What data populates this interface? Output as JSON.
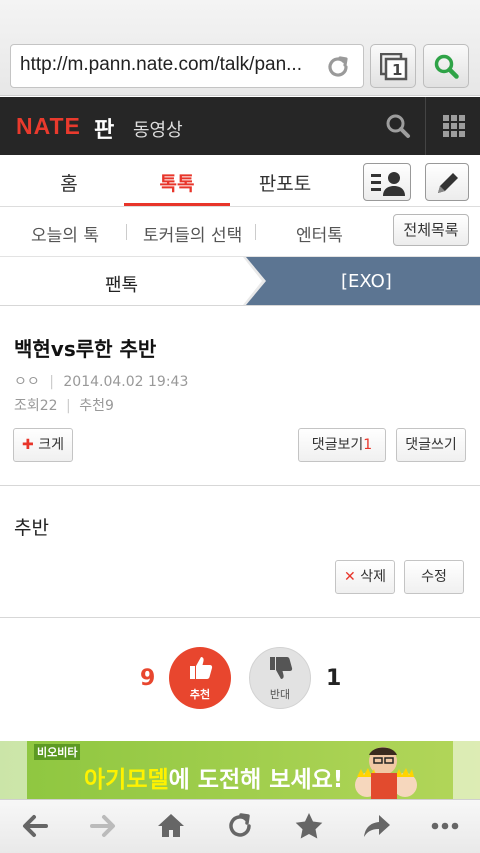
{
  "browser": {
    "url": "http://m.pann.nate.com/talk/pan...",
    "tab_count": "1",
    "icons": {
      "reload": "reload-icon",
      "tabs": "tabs-icon",
      "search": "search-icon"
    }
  },
  "site_header": {
    "logo": "NATE",
    "section": "판",
    "video_link": "동영상",
    "icons": {
      "search": "search-icon",
      "menu": "grid-menu-icon"
    },
    "colors": {
      "background": "#262626",
      "logo": "#e93a2d"
    }
  },
  "main_tabs": {
    "items": [
      {
        "label": "홈",
        "active": false
      },
      {
        "label": "톡톡",
        "active": true
      },
      {
        "label": "판포토",
        "active": false
      }
    ],
    "accent": "#e8352a"
  },
  "sub_menu": {
    "items": [
      "오늘의 톡",
      "토커들의 선택",
      "엔터톡"
    ],
    "full_list_label": "전체목록"
  },
  "breadcrumb": {
    "parent": "팬톡",
    "current": "[EXO]",
    "current_bg": "#5c7592"
  },
  "post": {
    "title": "백현vs루한 추반",
    "author": "ㅇㅇ",
    "date": "2014.04.02 19:43",
    "views_label": "조회",
    "views": "22",
    "recommend_label": "추천",
    "recommend": "9",
    "font_size_button": "크게",
    "view_comments_label": "댓글보기",
    "comment_count": "1",
    "write_comment_label": "댓글쓰기",
    "body": "추반",
    "delete_label": "삭제",
    "edit_label": "수정"
  },
  "votes": {
    "up_count": "9",
    "up_label": "추천",
    "down_count": "1",
    "down_label": "반대",
    "up_color": "#e8462e"
  },
  "banner": {
    "brand": "비오비타",
    "text_highlight": "아기모델",
    "text_rest": "에 도전해 보세요!"
  },
  "bottom_toolbar": {
    "icons": [
      "back-icon",
      "forward-icon",
      "home-icon",
      "reload-icon",
      "bookmark-star-icon",
      "share-icon",
      "more-icon"
    ]
  }
}
